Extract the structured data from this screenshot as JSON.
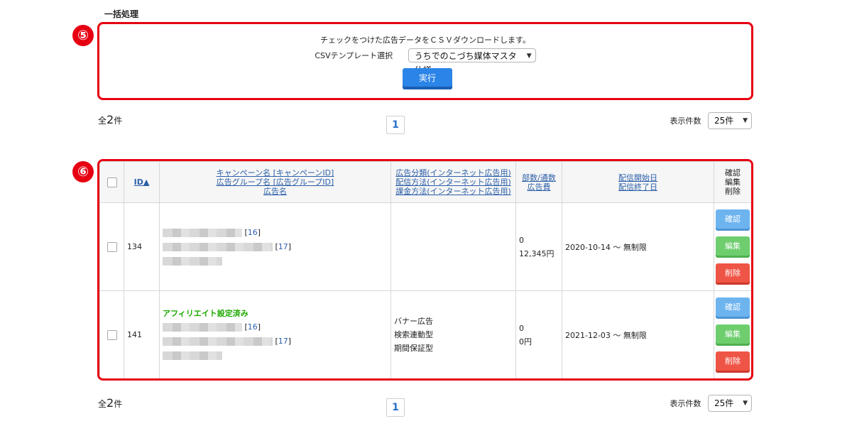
{
  "section_title": "一括処理",
  "callouts": {
    "five": "⑤",
    "six": "⑥"
  },
  "csv": {
    "message": "チェックをつけた広告データをＣＳＶダウンロードします。",
    "template_label": "CSVテンプレート選択",
    "template_selected": "うちでのこづち媒体マスタ仕様",
    "execute_label": "実行"
  },
  "summary": {
    "prefix": "全",
    "count": "2",
    "suffix": "件"
  },
  "pagination": {
    "current_page": "1"
  },
  "per_page": {
    "label": "表示件数",
    "selected": "25件"
  },
  "table": {
    "headers": {
      "id": "ID▲",
      "name_lines": [
        "キャンペーン名 [キャンペーンID]",
        "広告グループ名 [広告グループID]",
        "広告名"
      ],
      "category_lines": [
        "広告分類(インターネット広告用)",
        "配信方法(インターネット広告用)",
        "課金方法(インターネット広告用)"
      ],
      "quantity_lines": [
        "部数/通数",
        "広告費"
      ],
      "date_lines": [
        "配信開始日",
        "配信終了日"
      ],
      "actions_lines": [
        "確認",
        "編集",
        "削除"
      ]
    },
    "rows": [
      {
        "id": "134",
        "affiliate": "",
        "campaign_id": "16",
        "group_id": "17",
        "category": "",
        "delivery": "",
        "billing": "",
        "quantity": "0",
        "cost": "12,345円",
        "period": "2020-10-14 ～ 無制限"
      },
      {
        "id": "141",
        "affiliate": "アフィリエイト設定済み",
        "campaign_id": "16",
        "group_id": "17",
        "category": "バナー広告",
        "delivery": "検索連動型",
        "billing": "期間保証型",
        "quantity": "0",
        "cost": "0円",
        "period": "2021-12-03 ～ 無制限"
      }
    ],
    "actions": {
      "confirm": "確認",
      "edit": "編集",
      "delete": "削除"
    }
  },
  "colors": {
    "highlight": "#e60012",
    "primary": "#2b84e8",
    "confirm": "#6db4ef",
    "edit": "#6ece6e",
    "delete": "#ef5546",
    "affiliate": "#1ea800",
    "link": "#2b5fa8"
  },
  "icons": {
    "select": "chevron-down-icon",
    "checkbox": "checkbox-icon"
  }
}
